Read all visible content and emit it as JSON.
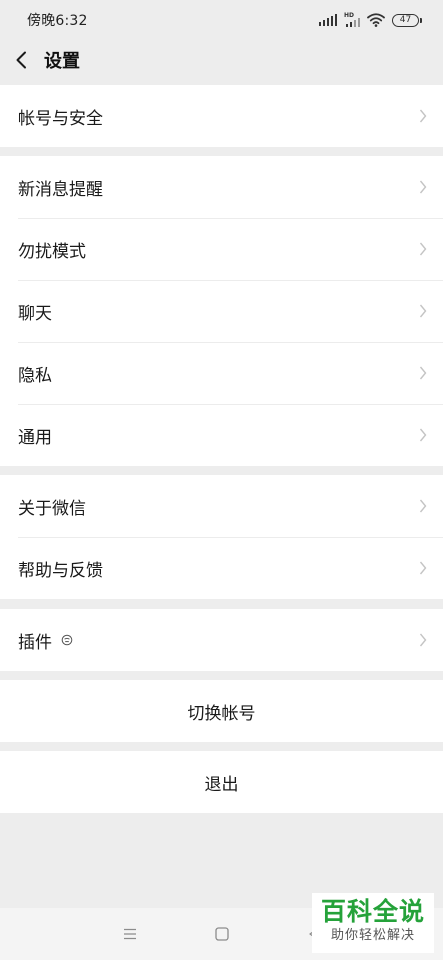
{
  "status_bar": {
    "time": "傍晚6:32",
    "hd_label": "HD",
    "battery": "47"
  },
  "header": {
    "title": "设置",
    "back_icon": "chevron-left-icon"
  },
  "groups": [
    {
      "items": [
        {
          "label": "帐号与安全"
        }
      ]
    },
    {
      "items": [
        {
          "label": "新消息提醒"
        },
        {
          "label": "勿扰模式"
        },
        {
          "label": "聊天"
        },
        {
          "label": "隐私"
        },
        {
          "label": "通用"
        }
      ]
    },
    {
      "items": [
        {
          "label": "关于微信"
        },
        {
          "label": "帮助与反馈"
        }
      ]
    },
    {
      "items": [
        {
          "label": "插件",
          "icon": "plugin-badge-icon"
        }
      ]
    }
  ],
  "actions": {
    "switch_account": "切换帐号",
    "logout": "退出"
  },
  "nav": {
    "menu_icon": "menu-icon",
    "home_icon": "home-square-icon",
    "back_icon": "back-triangle-icon"
  },
  "watermark": {
    "main": "百科全说",
    "sub": "助你轻松解决"
  },
  "colors": {
    "background": "#ededed",
    "cell": "#ffffff",
    "watermark_green": "#25a23a"
  }
}
